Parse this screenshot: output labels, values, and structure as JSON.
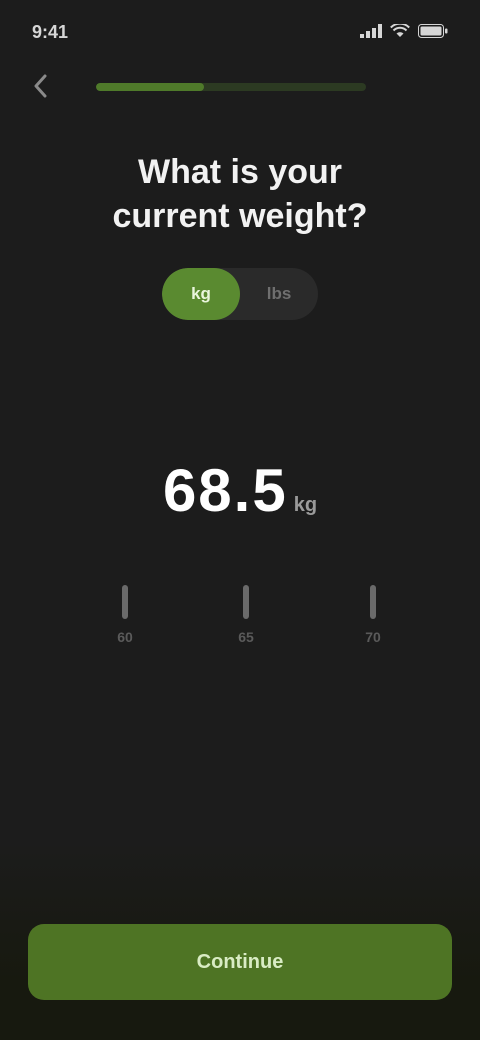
{
  "status_bar": {
    "time": "9:41",
    "carrier_icon": "signal-icon",
    "wifi_icon": "wifi-icon",
    "battery_icon": "battery-icon"
  },
  "header": {
    "back_icon": "chevron-left-icon",
    "progress_percent": 40
  },
  "question": {
    "line1": "What is your",
    "line2": "current weight?"
  },
  "unit_toggle": {
    "options": [
      "kg",
      "lbs"
    ],
    "selected": "kg"
  },
  "value": {
    "number": "68.5",
    "unit": "kg"
  },
  "ruler": {
    "labels": [
      "60",
      "65",
      "70"
    ]
  },
  "footer": {
    "continue_label": "Continue"
  },
  "colors": {
    "background": "#1c1c1c",
    "accent": "#5a8a30",
    "button": "#4e7424"
  }
}
